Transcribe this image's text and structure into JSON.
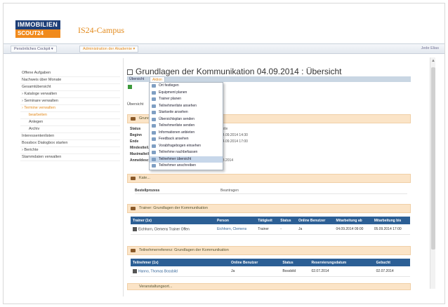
{
  "header": {
    "logo_line1": "IMMOBILIEN",
    "logo_line2": "SCOUT24",
    "app_title": "IS24-Campus"
  },
  "nav": {
    "items": [
      "Persönliches Cockpit ▾",
      "Administration der Akademie ▾"
    ],
    "right": "Jede Elias"
  },
  "sidebar": {
    "items": [
      {
        "label": "Offene Aufgaben"
      },
      {
        "label": "Nachweis über Monate"
      },
      {
        "label": "Gesamtübersicht"
      },
      {
        "label": "› Kataloge verwalten"
      },
      {
        "label": "› Seminare verwalten"
      },
      {
        "label": "› Termine verwalten"
      },
      {
        "label": "bearbeiten"
      },
      {
        "label": "Anlegen"
      },
      {
        "label": "Archiv"
      },
      {
        "label": "Interessentenlisten"
      },
      {
        "label": "Bossbox Dialogbox starten"
      },
      {
        "label": "› Berichte"
      },
      {
        "label": "Stammdaten verwalten"
      }
    ]
  },
  "page": {
    "title": "Grundlagen der Kommunikation 04.09.2014 : Übersicht",
    "tabs": [
      "Übersicht",
      "Aktion"
    ],
    "subtitle": "Übersicht"
  },
  "menu": {
    "items": [
      "Ort festlegen",
      "Equipment planen",
      "Trainer planen",
      "Teilnehmerliste ansehen",
      "Startseite ansehen",
      "Übersichtsplan senden",
      "Teilnehmerliste senden",
      "Informationen anbieten",
      "Feedback ansehen",
      "Vorabfragebogen einsehen",
      "Teilnehme nachbefassen",
      "Teilnehmer übersicht",
      "Teilnehmer anschreiben"
    ]
  },
  "details": {
    "section_title": "Grundl...                                                 14",
    "rows": [
      {
        "k": "Status",
        "v": "aktiv"
      },
      {
        "k": "Beginn",
        "v": "04.09.2014 14:30"
      },
      {
        "k": "Ende",
        "v": "04.09.2014 17:00"
      },
      {
        "k": "Mindestteil.",
        "v": ""
      },
      {
        "k": "Maximalteil.",
        "v": ""
      },
      {
        "k": "Anmeldeschluss",
        "v": "03.2014"
      }
    ]
  },
  "kategorie": {
    "section_title": "Kate...",
    "row_key": "Bestellprozess",
    "row_value": "Beantragen"
  },
  "trainer": {
    "section_title": "Trainer: Grundlagen der Kommunikation",
    "columns": [
      "Trainer (1x)",
      "Person",
      "Tätigkeit",
      "Status",
      "Online Benutzer",
      "Mitarbeitung ab",
      "Mitarbeitung bis"
    ],
    "rows": [
      [
        "Eichhorn, Clemens Trainer Offen",
        "Eichhorn, Clemens",
        "Trainer",
        "-",
        "Ja",
        "04.09.2014 09:00",
        "05.09.2014 17:00"
      ]
    ]
  },
  "teilnehmer": {
    "section_title": "Teilnehmerreferenz: Grundlagen der Kommunikation",
    "columns": [
      "Teilnehmer (1x)",
      "Online Benutzer",
      "Status",
      "Reservierungsdatum",
      "Gebucht"
    ],
    "rows": [
      [
        "Hanno, Thomas Bossbild",
        "Ja",
        "Bossbild",
        "02.07.2014",
        "02.07.2014"
      ]
    ]
  },
  "footer_section": "Veranstaltungsort..."
}
